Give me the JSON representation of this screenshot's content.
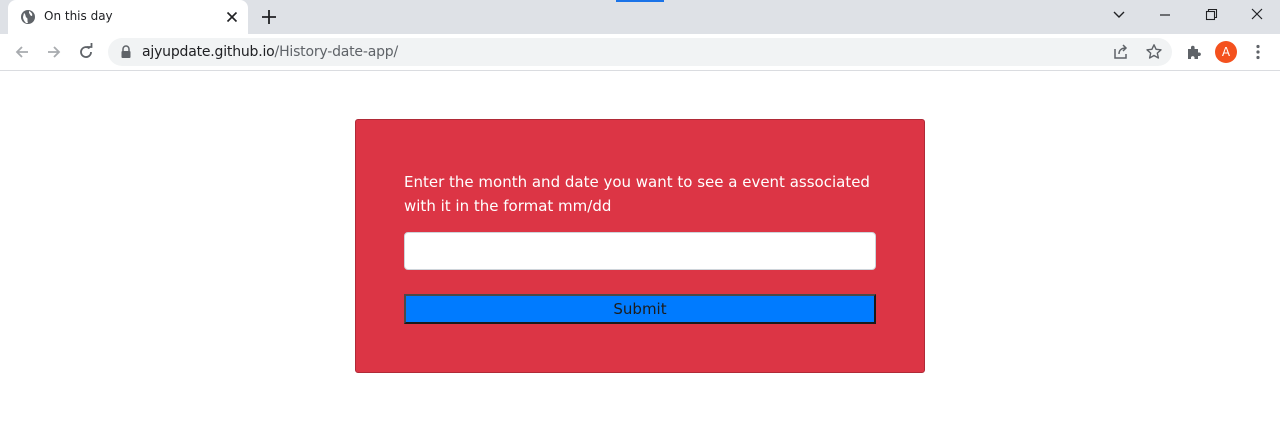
{
  "browser": {
    "tab_title": "On this day",
    "url_host": "ajyupdate.github.io",
    "url_path": "/History-date-app/",
    "profile_initial": "A",
    "profile_color": "#f4511e",
    "icons": [
      "globe-icon",
      "close-icon",
      "plus-icon",
      "chevron-down-icon",
      "minimize-icon",
      "restore-icon",
      "close-window-icon",
      "back-icon",
      "forward-icon",
      "reload-icon",
      "lock-icon",
      "share-icon",
      "star-icon",
      "extensions-icon",
      "more-icon"
    ]
  },
  "page": {
    "prompt": "Enter the month and date you want to see a event associated with it in the format mm/dd",
    "date_input_value": "",
    "submit_label": "Submit",
    "card_color": "#dc3545",
    "button_color": "#007bff"
  }
}
